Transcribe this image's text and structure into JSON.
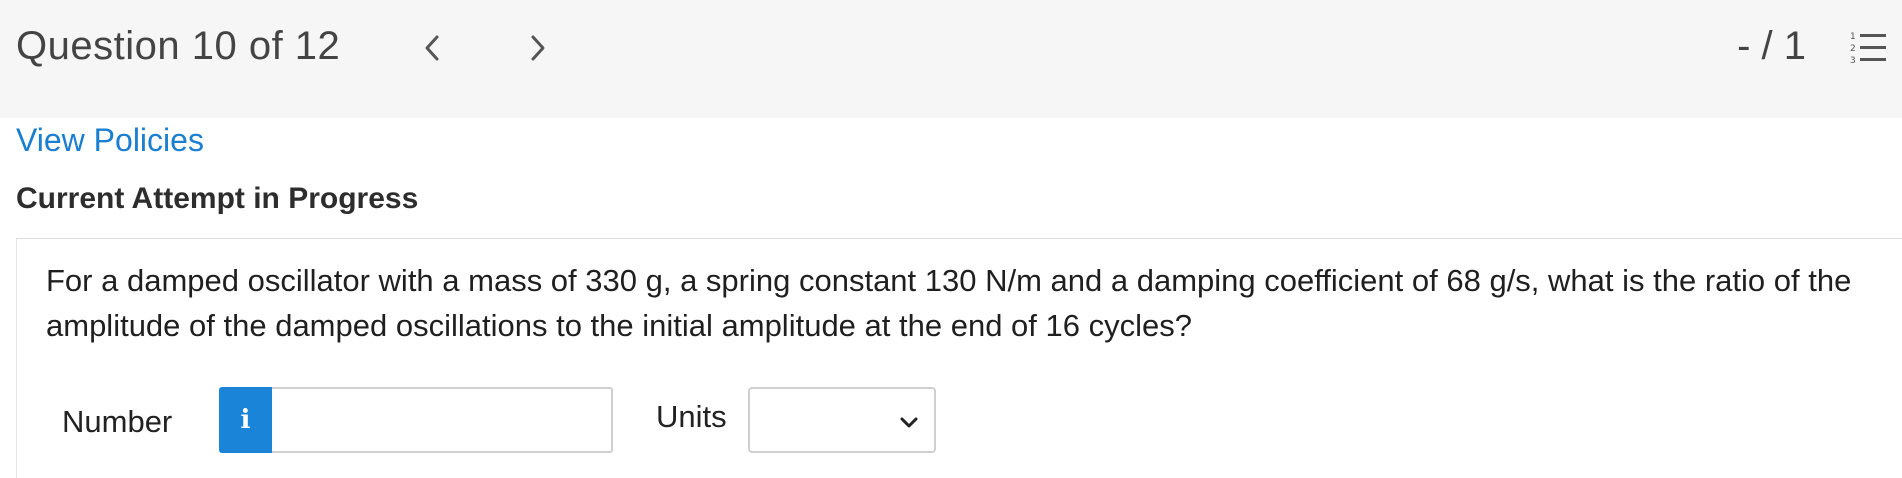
{
  "header": {
    "title": "Question 10 of 12",
    "score": "- / 1",
    "list_icon_numbers": "1 2 3"
  },
  "links": {
    "view_policies": "View Policies"
  },
  "attempt": {
    "status": "Current Attempt in Progress"
  },
  "question": {
    "text": "For a damped oscillator with a mass of 330 g, a spring constant 130 N/m and a damping coefficient of 68 g/s, what is the ratio of the amplitude of the damped oscillations to the initial amplitude at the end of 16 cycles?"
  },
  "answer": {
    "number_label": "Number",
    "info_icon": "i",
    "number_value": "",
    "number_placeholder": "",
    "units_label": "Units",
    "units_selected": ""
  },
  "colors": {
    "accent": "#1a84d8",
    "link": "#1a7fd1",
    "header_bg": "#f6f6f6"
  },
  "icons": {
    "prev": "chevron-left-icon",
    "next": "chevron-right-icon",
    "list": "numbered-list-icon",
    "info": "info-icon",
    "dropdown": "chevron-down-icon"
  }
}
